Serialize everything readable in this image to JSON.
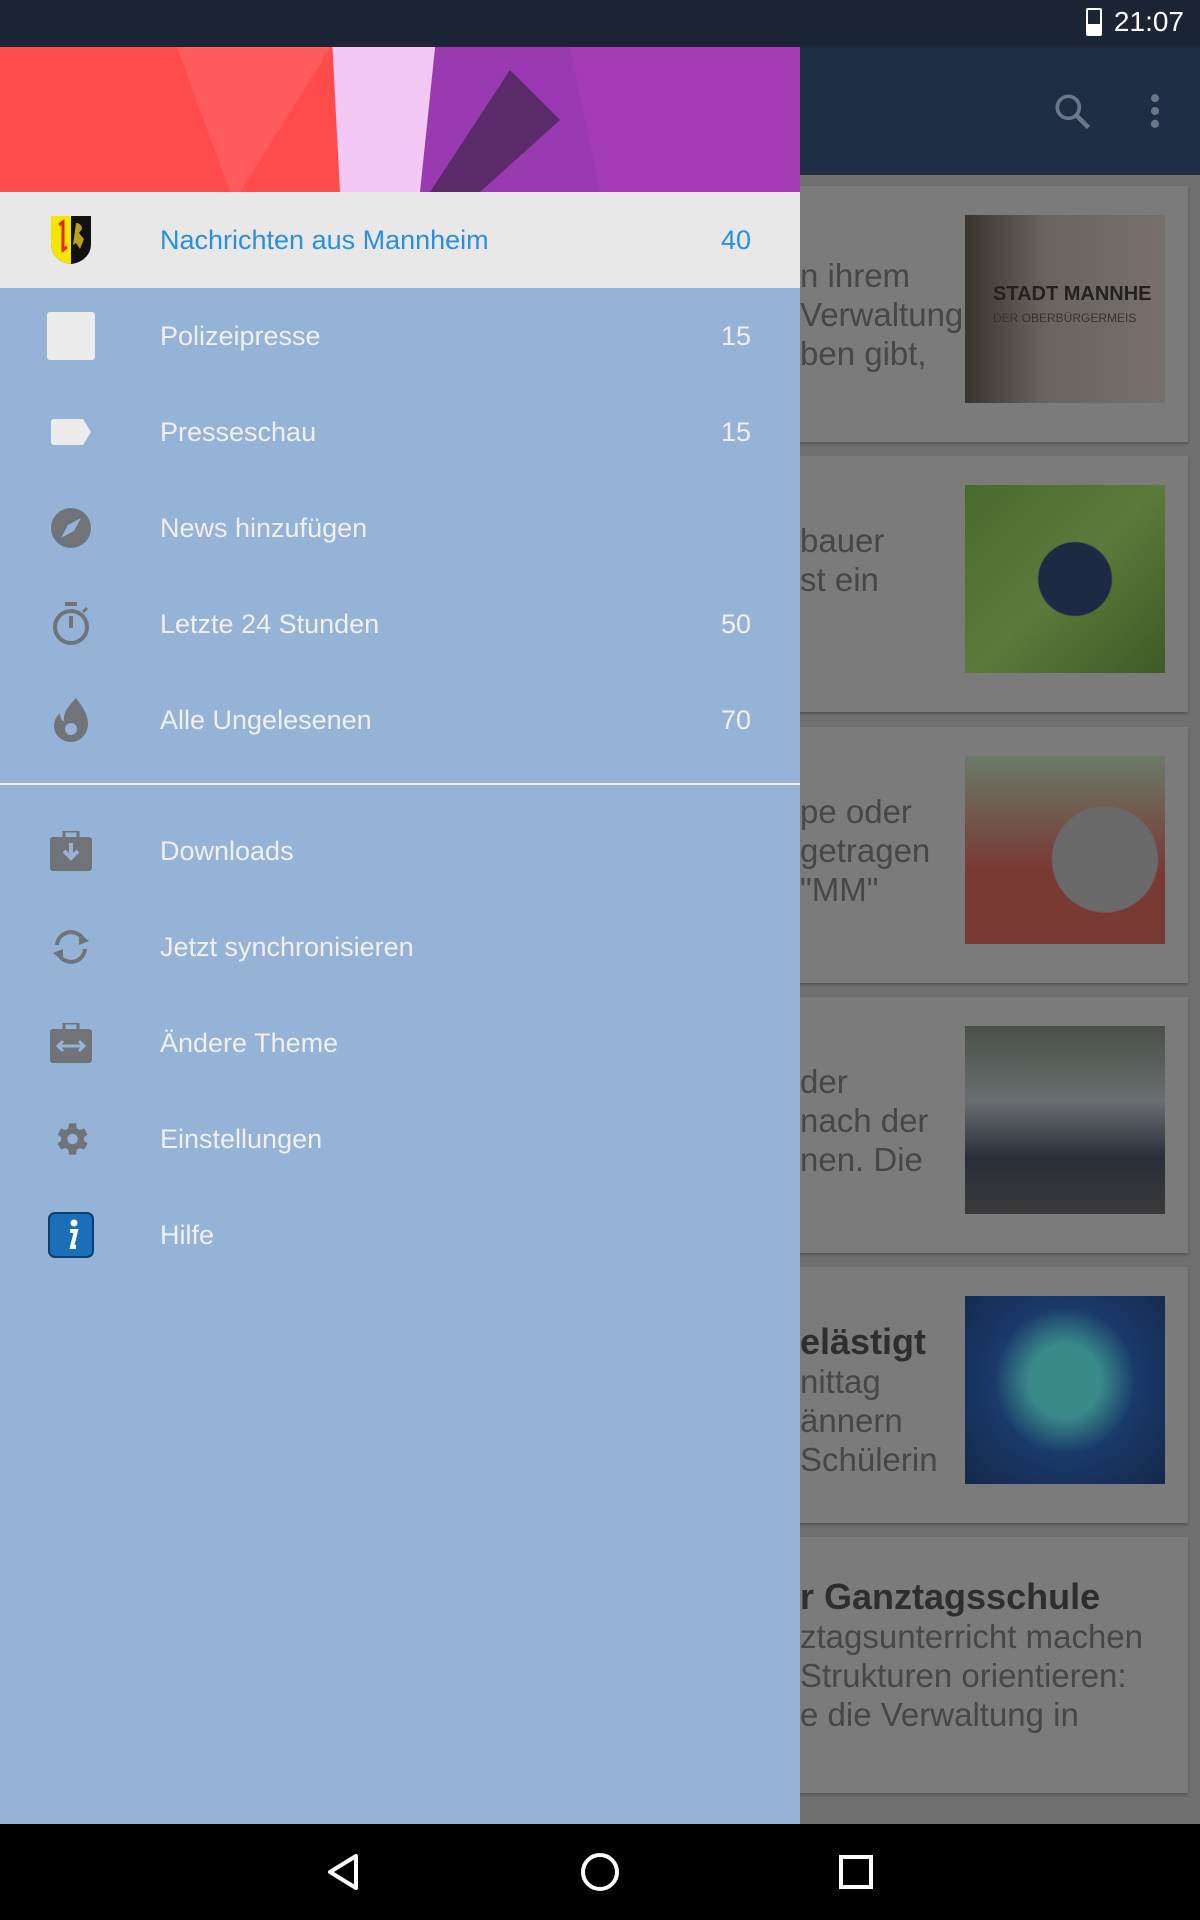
{
  "status_bar": {
    "time": "21:07",
    "battery_icon": "battery-icon"
  },
  "app_bar": {
    "search_icon": "search-icon",
    "menu_icon": "more-vert-icon"
  },
  "drawer": {
    "primary_items": [
      {
        "label": "Nachrichten aus Mannheim",
        "count": "40",
        "icon": "mannheim-coat-of-arms-icon",
        "selected": true
      },
      {
        "label": "Polizeipresse",
        "count": "15",
        "icon": "square-icon"
      },
      {
        "label": "Presseschau",
        "count": "15",
        "icon": "label-tag-icon"
      },
      {
        "label": "News hinzufügen",
        "count": "",
        "icon": "compass-icon"
      },
      {
        "label": "Letzte 24 Stunden",
        "count": "50",
        "icon": "stopwatch-icon"
      },
      {
        "label": "Alle Ungelesenen",
        "count": "70",
        "icon": "flame-icon"
      }
    ],
    "secondary_items": [
      {
        "label": "Downloads",
        "icon": "download-briefcase-icon"
      },
      {
        "label": "Jetzt synchronisieren",
        "icon": "sync-icon"
      },
      {
        "label": "Ändere Theme",
        "icon": "theme-switch-icon"
      },
      {
        "label": "Einstellungen",
        "icon": "gear-icon"
      },
      {
        "label": "Hilfe",
        "icon": "info-icon"
      }
    ],
    "accent_color": "#2a8fe0",
    "background_color": "#94b3d7"
  },
  "feed": {
    "cards": [
      {
        "title": "",
        "lines": [
          "n ihrem",
          "Verwaltung",
          "ben gibt,"
        ]
      },
      {
        "title": "",
        "lines": [
          "bauer",
          "st ein"
        ]
      },
      {
        "title": "",
        "lines": [
          "pe oder",
          "getragen",
          "\"MM\""
        ]
      },
      {
        "title": "",
        "lines": [
          "der",
          "nach der",
          "nen. Die"
        ]
      },
      {
        "title": "elästigt",
        "lines": [
          "nittag",
          "ännern",
          "Schülerin"
        ]
      },
      {
        "title": "r Ganztagsschule",
        "lines": [
          "ztagsunterricht machen",
          "Strukturen orientieren:",
          "e die Verwaltung in"
        ]
      }
    ],
    "image_captions": {
      "card1_sign": "STADT MANNHE",
      "card1_sign_sub": "DER OBERBÜRGERMEIS"
    }
  },
  "nav_bar": {
    "back": "back-icon",
    "home": "home-icon",
    "recents": "recents-icon"
  }
}
